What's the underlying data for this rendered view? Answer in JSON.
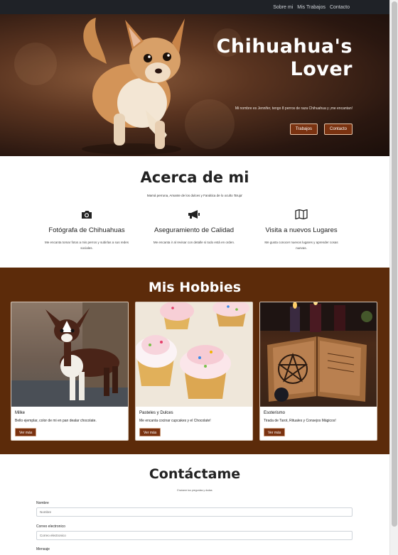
{
  "nav": {
    "items": [
      "Sobre mi",
      "Mis Trabajos",
      "Contacto"
    ]
  },
  "hero": {
    "title_line1": "Chihuahua's",
    "title_line2": "Lover",
    "subtitle": "Mi nombre es Jennifer, tengo 8 perros de raza Chihuahua y ¡me encantan!",
    "btn_works": "Trabajos",
    "btn_contact": "Contacto"
  },
  "about": {
    "title": "Acerca de mi",
    "subtitle": "Mamá perruna, Amante de los dulces y Fanática de lo oculto 'Bruja'",
    "features": [
      {
        "icon": "camera-icon",
        "title": "Fotógrafa de Chihuahuas",
        "text": "Me encanta tomar fotos a mis perros y subirlas a sus redes sociales."
      },
      {
        "icon": "megaphone-icon",
        "title": "Aseguramiento de Calidad",
        "text": "Me encanta ir al revisar con detalle si todo está en orden."
      },
      {
        "icon": "map-icon",
        "title": "Visita a nuevos Lugares",
        "text": "Me gusta conocer nuevos lugares y aprender cosas nuevas."
      }
    ]
  },
  "hobbies": {
    "title": "Mis Hobbies",
    "cards": [
      {
        "title": "Milke",
        "text": "Bello ejemplar, color de mi en pan dealar chocolate.",
        "button": "Ver más"
      },
      {
        "title": "Pasteles y Dulces",
        "text": "Me encanta cocinar cupcakes y el Chocolate!",
        "button": "Ver más"
      },
      {
        "title": "Esoterismo",
        "text": "Tirada de Tarot, Rituales y Consejos Mágicos!",
        "button": "Ver más"
      }
    ]
  },
  "contact": {
    "title": "Contáctame",
    "subtitle": "Envíame tus preguntas y dudas",
    "name_label": "Nombre",
    "name_placeholder": "Nombre",
    "email_label": "Correo electronico",
    "email_placeholder": "Correo electronico",
    "message_label": "Mensaje"
  },
  "colors": {
    "nav_bg": "#1f2227",
    "accent_brown": "#5c2b0a",
    "button_brown": "#7a3210"
  }
}
